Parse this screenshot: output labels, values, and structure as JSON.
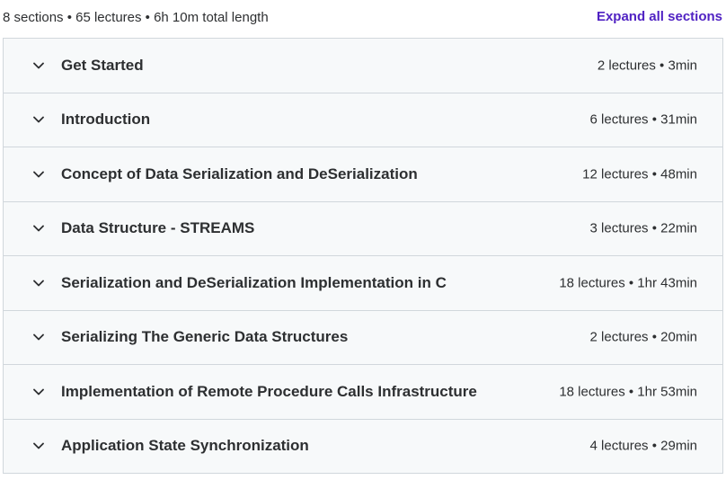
{
  "header": {
    "summary": "8 sections • 65 lectures • 6h 10m total length",
    "expand_all_label": "Expand all sections"
  },
  "colors": {
    "accent": "#5022c3",
    "row_background": "#f7f9fa",
    "border": "#d1d7dc",
    "text": "#2d2f31"
  },
  "icons": {
    "row_toggle": "chevron-down-icon"
  },
  "sections": [
    {
      "title": "Get Started",
      "meta": "2 lectures • 3min"
    },
    {
      "title": "Introduction",
      "meta": "6 lectures • 31min"
    },
    {
      "title": "Concept of Data Serialization and DeSerialization",
      "meta": "12 lectures • 48min"
    },
    {
      "title": "Data Structure - STREAMS",
      "meta": "3 lectures • 22min"
    },
    {
      "title": "Serialization and DeSerialization Implementation in C",
      "meta": "18 lectures • 1hr 43min"
    },
    {
      "title": "Serializing The Generic Data Structures",
      "meta": "2 lectures • 20min"
    },
    {
      "title": "Implementation of Remote Procedure Calls Infrastructure",
      "meta": "18 lectures • 1hr 53min"
    },
    {
      "title": "Application State Synchronization",
      "meta": "4 lectures • 29min"
    }
  ]
}
